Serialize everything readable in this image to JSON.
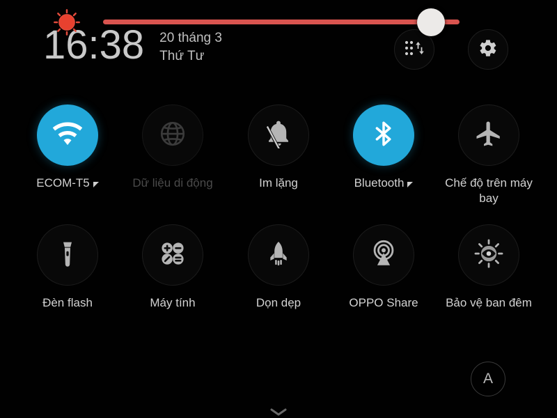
{
  "header": {
    "time": "16:38",
    "date": "20 tháng 3",
    "weekday": "Thứ Tư",
    "edit_toggles_icon": "grid-arrows-icon",
    "settings_icon": "gear-icon"
  },
  "theme": {
    "background": "#000000",
    "active_tile": "#22a8da",
    "tile_inactive_ring": "#1c1c1c",
    "label": "#d2d2d2",
    "label_disabled": "#4a4a4a",
    "slider_track": "#d9544f",
    "slider_thumb": "#eceae8"
  },
  "tiles": [
    {
      "label": "ECOM-T5",
      "icon": "wifi-icon",
      "state": "on",
      "expandable": true,
      "disabled": false
    },
    {
      "label": "Dữ liệu di động",
      "icon": "globe-icon",
      "state": "off",
      "expandable": false,
      "disabled": true
    },
    {
      "label": "Im lặng",
      "icon": "bell-slash-icon",
      "state": "off",
      "expandable": false,
      "disabled": false
    },
    {
      "label": "Bluetooth",
      "icon": "bluetooth-icon",
      "state": "on",
      "expandable": true,
      "disabled": false
    },
    {
      "label": "Chế độ trên máy bay",
      "icon": "airplane-icon",
      "state": "off",
      "expandable": false,
      "disabled": false
    },
    {
      "label": "Đèn flash",
      "icon": "flashlight-icon",
      "state": "off",
      "expandable": false,
      "disabled": false
    },
    {
      "label": "Máy tính",
      "icon": "calculator-icon",
      "state": "off",
      "expandable": false,
      "disabled": false
    },
    {
      "label": "Dọn dẹp",
      "icon": "rocket-icon",
      "state": "off",
      "expandable": false,
      "disabled": false
    },
    {
      "label": "OPPO Share",
      "icon": "broadcast-icon",
      "state": "off",
      "expandable": false,
      "disabled": false
    },
    {
      "label": "Bảo vệ ban đêm",
      "icon": "eye-care-icon",
      "state": "off",
      "expandable": false,
      "disabled": false
    }
  ],
  "brightness": {
    "icon": "brightness-contrast-icon",
    "value_percent": 92,
    "auto_label": "A",
    "auto_icon": "auto-brightness-button"
  },
  "footer": {
    "handle_icon": "chevron-down-icon"
  }
}
